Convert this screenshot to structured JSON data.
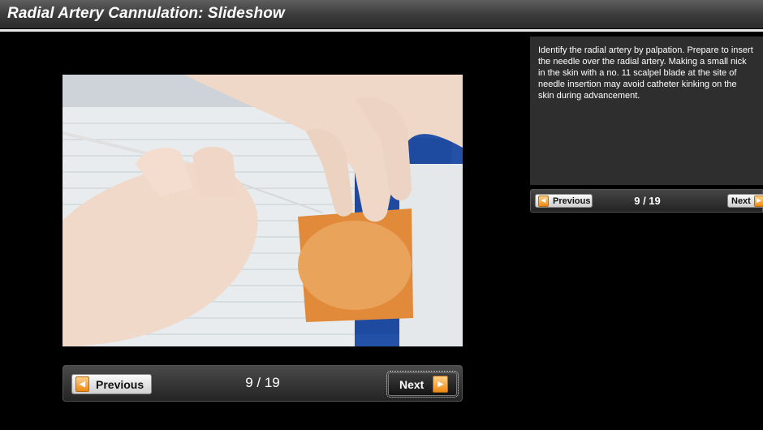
{
  "header": {
    "title": "Radial Artery Cannulation: Slideshow"
  },
  "slide": {
    "image_alt": "Photo: gloved hands palpating the radial artery at the wrist while inserting a catheter needle",
    "caption": "Identify the radial artery by palpation. Prepare to insert the needle over the radial artery. Making a small nick in the skin with a no. 11 scalpel blade at the site of needle insertion may avoid catheter kinking on the skin during advancement."
  },
  "nav": {
    "prev_label": "Previous",
    "next_label": "Next",
    "counter": "9 / 19",
    "current": 9,
    "total": 19
  },
  "icons": {
    "prev": "arrow-left-icon",
    "next": "arrow-right-icon"
  },
  "colors": {
    "accent": "#ef8a14",
    "background": "#000000",
    "panel": "#2e2e2e"
  }
}
